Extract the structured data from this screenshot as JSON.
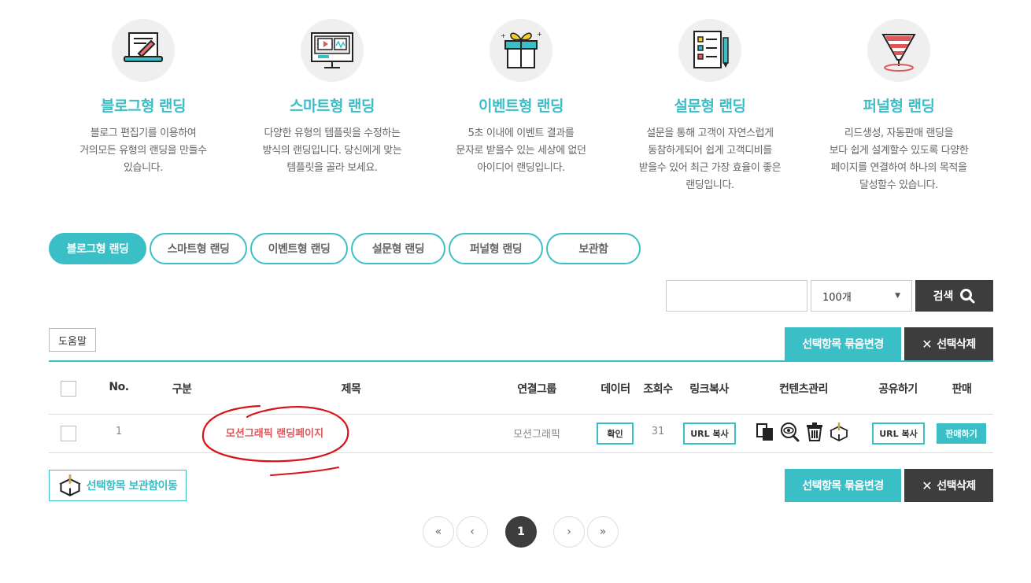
{
  "features": [
    {
      "title": "블로그형 랜딩",
      "desc": "블로그 편집기를 이용하여\n거의모든 유형의 랜딩을 만들수\n있습니다.",
      "icon": "blog-editor-icon"
    },
    {
      "title": "스마트형 랜딩",
      "desc": "다양한 유형의 템플릿을 수정하는\n방식의 랜딩입니다. 당신에게 맞는\n템플릿을 골라 보세요.",
      "icon": "monitor-template-icon"
    },
    {
      "title": "이벤트형 랜딩",
      "desc": "5초 이내에 이벤트 결과를\n문자로 받을수 있는 세상에 없던\n아이디어 랜딩입니다.",
      "icon": "gift-box-icon"
    },
    {
      "title": "설문형 랜딩",
      "desc": "설문을 통해 고객이 자연스럽게\n동참하게되어 쉽게 고객디비를\n받을수 있어 최근 가장 효율이 좋은\n랜딩입니다.",
      "icon": "survey-checklist-icon"
    },
    {
      "title": "퍼널형 랜딩",
      "desc": "리드생성, 자동판매 랜딩을\n보다 쉽게 설계할수 있도록 다양한\n페이지를 연결하여 하나의 목적을\n달성할수 있습니다.",
      "icon": "funnel-icon"
    }
  ],
  "tabs": [
    {
      "label": "블로그형 랜딩",
      "active": true
    },
    {
      "label": "스마트형 랜딩",
      "active": false
    },
    {
      "label": "이벤트형 랜딩",
      "active": false
    },
    {
      "label": "설문형 랜딩",
      "active": false
    },
    {
      "label": "퍼널형 랜딩",
      "active": false
    },
    {
      "label": "보관함",
      "active": false
    }
  ],
  "search": {
    "value": "",
    "page_size": "100개",
    "button_label": "검색"
  },
  "help_label": "도움말",
  "actions": {
    "bulk_change": "선택항목 묶음변경",
    "delete_selected": "선택삭제",
    "move_to_storage": "선택항목 보관함이동"
  },
  "table": {
    "headers": [
      "No.",
      "구분",
      "제목",
      "연결그룹",
      "데이터",
      "조회수",
      "링크복사",
      "컨텐츠관리",
      "공유하기",
      "판매"
    ],
    "rows": [
      {
        "no": "1",
        "category": "",
        "title": "모션그래픽 랜딩페이지",
        "group": "모션그래픽",
        "data_btn": "확인",
        "views": "31",
        "link_copy": "URL 복사",
        "share": "URL 복사",
        "sell": "판매하기"
      }
    ]
  },
  "pagination": {
    "first": "«",
    "prev": "‹",
    "current": "1",
    "next": "›",
    "last": "»"
  },
  "colors": {
    "accent": "#3bbfc7",
    "dark": "#3d3d3d",
    "title_red": "#e0575b",
    "annotation": "#d8141a"
  }
}
